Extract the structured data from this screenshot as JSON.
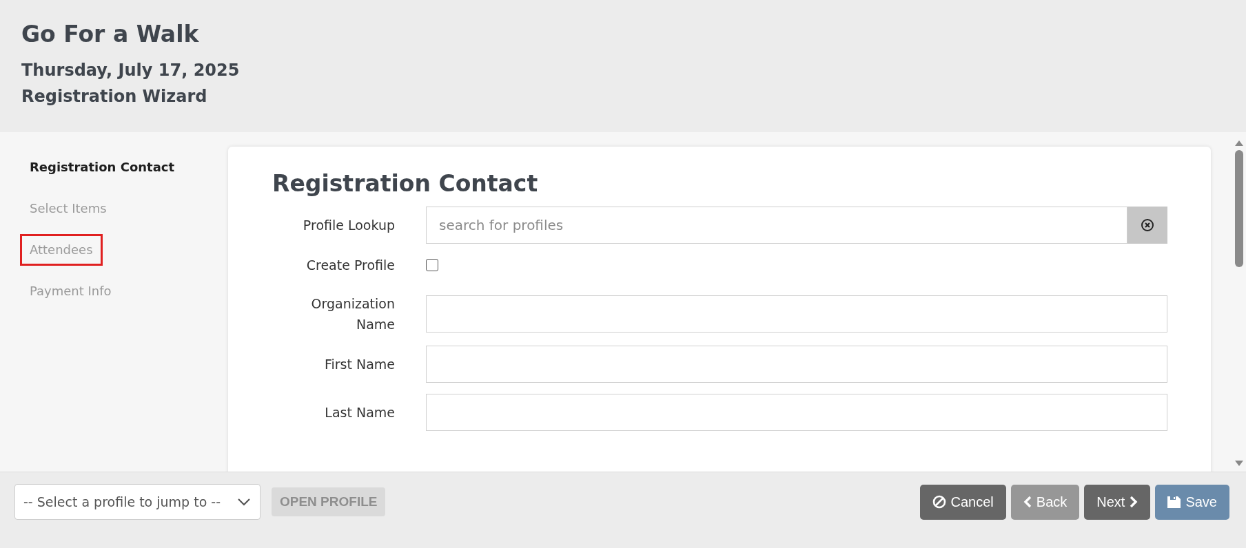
{
  "header": {
    "title": "Go For a Walk",
    "date": "Thursday, July 17, 2025",
    "subtitle": "Registration Wizard"
  },
  "sidebar": {
    "items": [
      {
        "label": "Registration Contact",
        "selected": true,
        "highlighted": false
      },
      {
        "label": "Select Items",
        "selected": false,
        "highlighted": false
      },
      {
        "label": "Attendees",
        "selected": false,
        "highlighted": true
      },
      {
        "label": "Payment Info",
        "selected": false,
        "highlighted": false
      }
    ]
  },
  "form": {
    "heading": "Registration Contact",
    "fields": [
      {
        "kind": "lookup",
        "label": "Profile Lookup",
        "placeholder": "search for profiles"
      },
      {
        "kind": "checkbox",
        "label": "Create Profile",
        "checked": false
      },
      {
        "kind": "text",
        "label": "Organization Name"
      },
      {
        "kind": "text",
        "label": "First Name"
      },
      {
        "kind": "text",
        "label": "Last Name"
      }
    ]
  },
  "footer": {
    "profile_select": {
      "placeholder": "-- Select a profile to jump to --"
    },
    "open_profile": {
      "label": "OPEN PROFILE",
      "disabled": true
    },
    "buttons": [
      {
        "kind": "cancel",
        "label": "Cancel",
        "disabled": false
      },
      {
        "kind": "back",
        "label": "Back",
        "disabled": true
      },
      {
        "kind": "next",
        "label": "Next",
        "disabled": false
      },
      {
        "kind": "save",
        "label": "Save",
        "disabled": false
      }
    ]
  }
}
